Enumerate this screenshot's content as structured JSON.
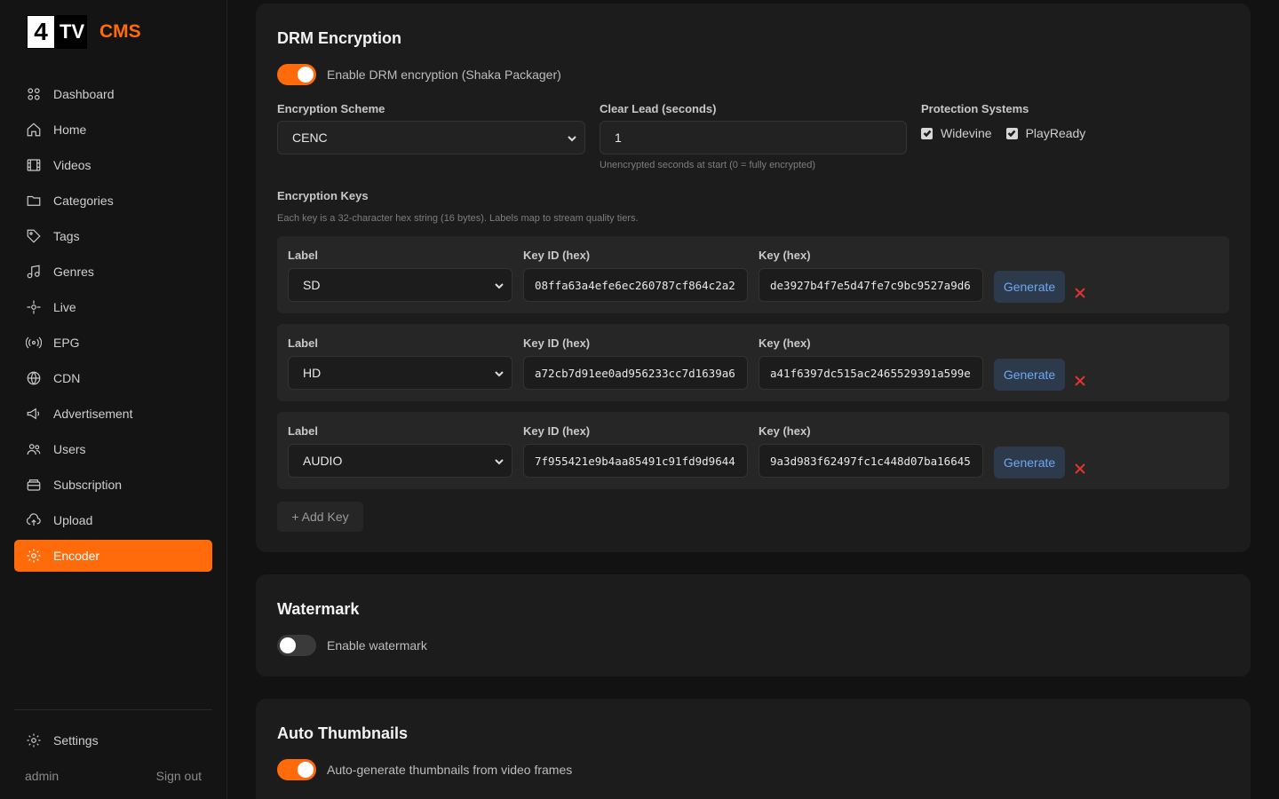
{
  "brand": {
    "logo_number": "4",
    "logo_tv": "TV",
    "logo_cms": "CMS"
  },
  "sidebar": {
    "items": [
      {
        "label": "Dashboard",
        "icon": "grid-icon"
      },
      {
        "label": "Home",
        "icon": "home-icon"
      },
      {
        "label": "Videos",
        "icon": "film-icon"
      },
      {
        "label": "Categories",
        "icon": "folder-icon"
      },
      {
        "label": "Tags",
        "icon": "tag-icon"
      },
      {
        "label": "Genres",
        "icon": "music-icon"
      },
      {
        "label": "Live",
        "icon": "live-icon"
      },
      {
        "label": "EPG",
        "icon": "broadcast-icon"
      },
      {
        "label": "CDN",
        "icon": "globe-icon"
      },
      {
        "label": "Advertisement",
        "icon": "megaphone-icon"
      },
      {
        "label": "Users",
        "icon": "users-icon"
      },
      {
        "label": "Subscription",
        "icon": "wallet-icon"
      },
      {
        "label": "Upload",
        "icon": "upload-icon"
      },
      {
        "label": "Encoder",
        "icon": "gear-icon",
        "active": true
      }
    ],
    "settings_label": "Settings",
    "user": "admin",
    "sign_out": "Sign out"
  },
  "drm": {
    "title": "DRM Encryption",
    "toggle_label": "Enable DRM encryption (Shaka Packager)",
    "toggle_on": true,
    "scheme_label": "Encryption Scheme",
    "scheme_value": "CENC",
    "clear_lead_label": "Clear Lead (seconds)",
    "clear_lead_value": "1",
    "clear_lead_hint": "Unencrypted seconds at start (0 = fully encrypted)",
    "protection_label": "Protection Systems",
    "protection": [
      {
        "label": "Widevine",
        "checked": true
      },
      {
        "label": "PlayReady",
        "checked": true
      }
    ],
    "keys_label": "Encryption Keys",
    "keys_hint": "Each key is a 32-character hex string (16 bytes). Labels map to stream quality tiers.",
    "col_label": "Label",
    "col_key_id": "Key ID (hex)",
    "col_key": "Key (hex)",
    "generate_label": "Generate",
    "keys": [
      {
        "label": "SD",
        "key_id": "08ffa63a4efe6ec260787cf864c2a2",
        "key": "de3927b4f7e5d47fe7c9bc9527a9d6"
      },
      {
        "label": "HD",
        "key_id": "a72cb7d91ee0ad956233cc7d1639a6",
        "key": "a41f6397dc515ac2465529391a599e"
      },
      {
        "label": "AUDIO",
        "key_id": "7f955421e9b4aa85491c91fd9d9644",
        "key": "9a3d983f62497fc1c448d07ba16645"
      }
    ],
    "add_key_label": "+ Add Key"
  },
  "watermark": {
    "title": "Watermark",
    "toggle_label": "Enable watermark",
    "toggle_on": false
  },
  "thumbnails": {
    "title": "Auto Thumbnails",
    "toggle_label": "Auto-generate thumbnails from video frames",
    "toggle_on": true
  },
  "colors": {
    "accent": "#ff6b0a",
    "danger": "#e03535",
    "link": "#6ea8f0"
  }
}
